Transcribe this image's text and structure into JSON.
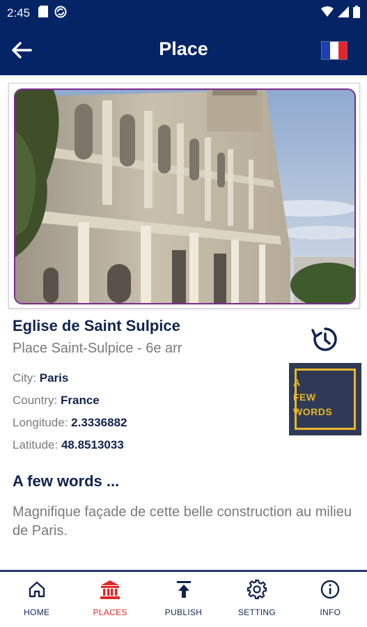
{
  "status_bar": {
    "time": "2:45",
    "icons": [
      "sd-card-icon",
      "sync-icon"
    ],
    "right_icons": [
      "wifi-icon",
      "signal-icon",
      "battery-icon"
    ]
  },
  "app_bar": {
    "title": "Place",
    "back_icon": "arrow-left-icon",
    "flag": "france-flag",
    "flag_colors": [
      "#1d3fb3",
      "#ffffff",
      "#e3262b"
    ]
  },
  "place": {
    "name": "Eglise de Saint Sulpice",
    "address": "Place Saint-Sulpice - 6e arr",
    "city_label": "City:",
    "city": "Paris",
    "country_label": "Country:",
    "country": "France",
    "longitude_label": "Longitude:",
    "longitude": "2.3336882",
    "latitude_label": "Latitude:",
    "latitude": "48.8513033"
  },
  "badge": {
    "line1": "A",
    "line2": "FEW",
    "line3": "WORDS"
  },
  "few_words": {
    "title": "A few words ...",
    "text": "Magnifique façade de cette belle construction au milieu de Paris."
  },
  "nav": {
    "items": [
      {
        "label": "HOME",
        "icon": "home-icon",
        "active": false
      },
      {
        "label": "PLACES",
        "icon": "monument-icon",
        "active": true
      },
      {
        "label": "PUBLISH",
        "icon": "upload-icon",
        "active": false
      },
      {
        "label": "SETTING",
        "icon": "gear-icon",
        "active": false
      },
      {
        "label": "INFO",
        "icon": "info-icon",
        "active": false
      }
    ]
  },
  "colors": {
    "primary": "#042466",
    "text_dark": "#10244f",
    "text_gray": "#7a7a7a",
    "active_nav": "#e02828",
    "badge_gold": "#e9b52a",
    "photo_border": "#7b2b8c"
  }
}
